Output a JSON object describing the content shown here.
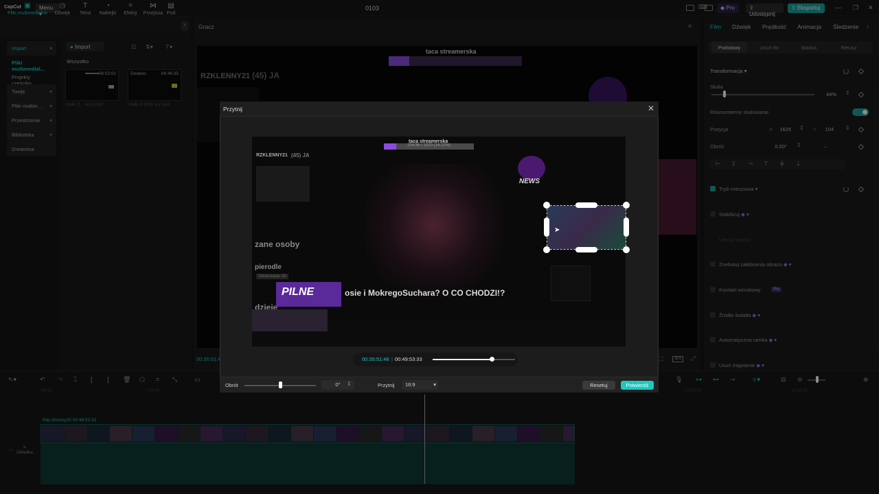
{
  "app": {
    "logo": "CapCut",
    "menu_label": "Menu",
    "project_title": "0103",
    "pro_label": "Pro",
    "share_label": "Udostępnij",
    "export_label": "Eksportuj"
  },
  "toolbar": {
    "tools": [
      {
        "label": "Pliki multimedialne",
        "icon": "media-icon"
      },
      {
        "label": "Dźwięk",
        "icon": "audio-icon"
      },
      {
        "label": "Tekst",
        "icon": "text-icon"
      },
      {
        "label": "Naklejki",
        "icon": "sticker-icon"
      },
      {
        "label": "Efekty",
        "icon": "effects-icon"
      },
      {
        "label": "Przejścia",
        "icon": "transition-icon"
      },
      {
        "label": "Pod",
        "icon": "caption-icon"
      }
    ]
  },
  "sidebar": {
    "items": [
      {
        "label": "Import"
      },
      {
        "label": "Pliki multimedial..."
      },
      {
        "label": "Projekty częściko..."
      },
      {
        "label": "Twoje"
      },
      {
        "label": "Pliki multim..."
      },
      {
        "label": "Przestrzenie"
      },
      {
        "label": "Biblioteka"
      },
      {
        "label": "Dreamina"
      }
    ]
  },
  "media": {
    "import_label": "Import",
    "section_label": "Wszystko",
    "clips": [
      {
        "duration": "08:53:02",
        "badge": "",
        "name": "zdalki (1 ...acj 3.mp4"
      },
      {
        "duration": "04:46:35",
        "badge": "Dodano",
        "name": "zdalki (0 800p ac) mp4"
      }
    ]
  },
  "player": {
    "header": "Gracz",
    "time_current": "00:35:51:46"
  },
  "video_overlay": {
    "stream_title": "taca streamerska",
    "progress_text": "234.56 / 1320 (14.12%)",
    "username": "RZKLENNY21",
    "count": "(45) JA",
    "news": "NEWS",
    "line1": "zane osoby",
    "line2": "pierodle",
    "line3": "dzieje",
    "sub": "Obserwacje Ok",
    "badge": "PILNE",
    "headline": "osie i MokregoSuchara? O CO CHODZI!?"
  },
  "right_panel": {
    "tabs": [
      "Film",
      "Dźwięk",
      "Prędkość",
      "Animacja",
      "Śledzenie"
    ],
    "subtabs": [
      "Podstawy",
      "Usuń tło",
      "Maska",
      "Retusz"
    ],
    "transform_label": "Transformacja",
    "scale_label": "Skala",
    "scale_value": "44%",
    "scale_level": 0.44,
    "uniform_label": "Równomierne skalowanie",
    "position_label": "Pozycja",
    "pos_x_label": "X",
    "pos_x": "1625",
    "pos_y_label": "Y",
    "pos_y": "104",
    "rotate_label": "Obróć",
    "rotate_value": "0.00°",
    "rotate_extra": "–",
    "blend_label": "Tryb mieszania",
    "stabilize_label": "Stabilizuj",
    "stabilize_sub": "Ulepsz jakość",
    "denoise_label": "Zredukuj zakłócenia obrazu",
    "eye_label": "Kontakt wzrokowy",
    "eye_badge": "Pro",
    "light_label": "Źródło światła",
    "frame_label": "Automatyczna ramka",
    "flicker_label": "Usuń migotanie"
  },
  "timeline": {
    "ruler": [
      "00:00",
      "l 00:00",
      "l 10:00:00",
      "l 10:30:00"
    ],
    "track_label": "Klip złożony25  00:49:53:33",
    "cover_label": "Okładka"
  },
  "crop_dialog": {
    "title": "Przytnij",
    "time_current": "00:35:51:46",
    "time_total": "00:49:53:33",
    "seek_progress": 0.72,
    "rotate_label": "Obrót",
    "rotate_value": "0°",
    "rotate_level": 0.5,
    "crop_label": "Przytnij",
    "ratio_value": "16:9",
    "reset_label": "Resetuj",
    "confirm_label": "Potwierdź"
  }
}
